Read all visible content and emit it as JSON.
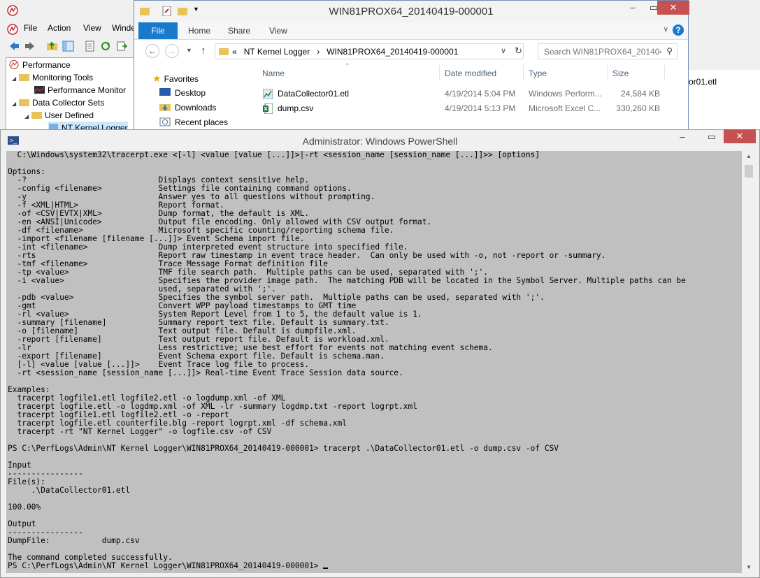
{
  "perfmon": {
    "menu": [
      "File",
      "Action",
      "View",
      "Winde"
    ],
    "tree": [
      {
        "label": "Performance",
        "icon": "performance-icon"
      },
      {
        "label": "Monitoring Tools",
        "icon": "folder-icon"
      },
      {
        "label": "Performance Monitor",
        "icon": "chart-icon"
      },
      {
        "label": "Data Collector Sets",
        "icon": "folder-icon"
      },
      {
        "label": "User Defined",
        "icon": "folder-icon"
      },
      {
        "label": "NT Kernel Logger",
        "icon": "collector-icon"
      }
    ],
    "right_partial_file": "or01.etl"
  },
  "explorer": {
    "title": "WIN81PROX64_20140419-000001",
    "ribbon_tabs": [
      "File",
      "Home",
      "Share",
      "View"
    ],
    "breadcrumb": [
      "«",
      "NT Kernel Logger",
      "›",
      "WIN81PROX64_20140419-000001"
    ],
    "search_placeholder": "Search WIN81PROX64_201404...",
    "nav": [
      "Favorites",
      "Desktop",
      "Downloads",
      "Recent places"
    ],
    "columns": [
      "Name",
      "Date modified",
      "Type",
      "Size"
    ],
    "files": [
      {
        "name": "DataCollector01.etl",
        "date": "4/19/2014 5:04 PM",
        "type": "Windows Perform...",
        "size": "24,584 KB",
        "icon": "etl-file-icon"
      },
      {
        "name": "dump.csv",
        "date": "4/19/2014 5:13 PM",
        "type": "Microsoft Excel C...",
        "size": "330,260 KB",
        "icon": "excel-file-icon"
      }
    ]
  },
  "powershell": {
    "title": "Administrator: Windows PowerShell",
    "output": "  C:\\Windows\\system32\\tracerpt.exe <[-l] <value [value [...]]>|-rt <session_name [session_name [...]]>> [options]\n\nOptions:\n  -?                            Displays context sensitive help.\n  -config <filename>            Settings file containing command options.\n  -y                            Answer yes to all questions without prompting.\n  -f <XML|HTML>                 Report format.\n  -of <CSV|EVTX|XML>            Dump format, the default is XML.\n  -en <ANSI|Unicode>            Output file encoding. Only allowed with CSV output format.\n  -df <filename>                Microsoft specific counting/reporting schema file.\n  -import <filename [filename [...]]> Event Schema import file.\n  -int <filename>               Dump interpreted event structure into specified file.\n  -rts                          Report raw timestamp in event trace header.  Can only be used with -o, not -report or -summary.\n  -tmf <filename>               Trace Message Format definition file\n  -tp <value>                   TMF file search path.  Multiple paths can be used, separated with ';'.\n  -i <value>                    Specifies the provider image path.  The matching PDB will be located in the Symbol Server. Multiple paths can be\n                                used, separated with ';'.\n  -pdb <value>                  Specifies the symbol server path.  Multiple paths can be used, separated with ';'.\n  -gmt                          Convert WPP payload timestamps to GMT time\n  -rl <value>                   System Report Level from 1 to 5, the default value is 1.\n  -summary [filename]           Summary report text file. Default is summary.txt.\n  -o [filename]                 Text output file. Default is dumpfile.xml.\n  -report [filename]            Text output report file. Default is workload.xml.\n  -lr                           Less restrictive; use best effort for events not matching event schema.\n  -export [filename]            Event Schema export file. Default is schema.man.\n  [-l] <value [value [...]]>    Event Trace log file to process.\n  -rt <session_name [session_name [...]]> Real-time Event Trace Session data source.\n\nExamples:\n  tracerpt logfile1.etl logfile2.etl -o logdump.xml -of XML\n  tracerpt logfile.etl -o logdmp.xml -of XML -lr -summary logdmp.txt -report logrpt.xml\n  tracerpt logfile1.etl logfile2.etl -o -report\n  tracerpt logfile.etl counterfile.blg -report logrpt.xml -df schema.xml\n  tracerpt -rt \"NT Kernel Logger\" -o logfile.csv -of CSV\n\nPS C:\\PerfLogs\\Admin\\NT Kernel Logger\\WIN81PROX64_20140419-000001> tracerpt .\\DataCollector01.etl -o dump.csv -of CSV\n\nInput\n----------------\nFile(s):\n     .\\DataCollector01.etl\n\n100.00%\n\nOutput\n----------------\nDumpFile:           dump.csv\n\nThe command completed successfully.\nPS C:\\PerfLogs\\Admin\\NT Kernel Logger\\WIN81PROX64_20140419-000001> "
  }
}
